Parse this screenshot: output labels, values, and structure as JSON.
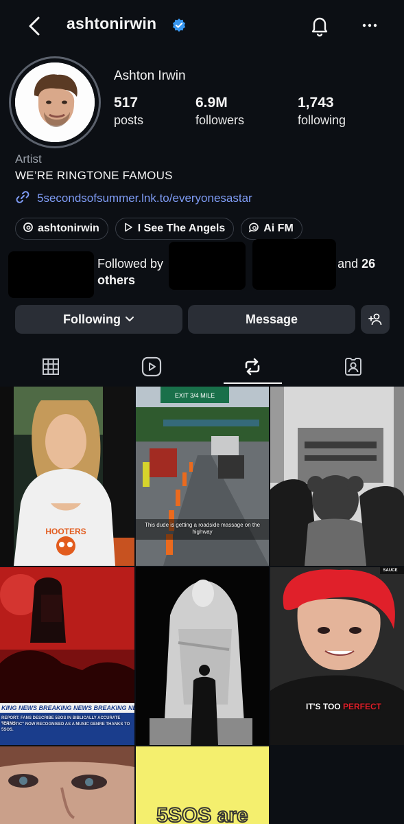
{
  "header": {
    "username": "ashtonirwin",
    "icons": [
      "chevron-left-icon",
      "verified-badge-icon",
      "bell-icon",
      "more-dots-icon"
    ]
  },
  "profile": {
    "display_name": "Ashton Irwin",
    "stats": {
      "posts": {
        "value": "517",
        "label": "posts"
      },
      "followers": {
        "value": "6.9M",
        "label": "followers"
      },
      "following": {
        "value": "1,743",
        "label": "following"
      }
    },
    "category": "Artist",
    "bio": "WE’RE RINGTONE FAMOUS",
    "link": "5secondsofsummer.lnk.to/everyonesastar",
    "chips": [
      {
        "label": "ashtonirwin",
        "icon": "threads-icon"
      },
      {
        "label": "I See The Angels",
        "icon": "play-icon"
      },
      {
        "label": "Ai FM",
        "icon": "chat-bubble-icon"
      }
    ],
    "followed_by": {
      "prefix": "Followed by",
      "comma": ",",
      "suffix_and": "and",
      "count": "26",
      "others": "others"
    }
  },
  "actions": {
    "following_label": "Following",
    "message_label": "Message",
    "add_user_icon": "add-user-icon"
  },
  "tabs": [
    "grid-icon",
    "reels-icon",
    "reposts-icon",
    "tagged-icon"
  ],
  "active_tab": "reposts",
  "grid": {
    "captions": {
      "roadside": "This dude is getting a roadside massage on the highway",
      "sign_exit": "EXIT 3/4 MILE",
      "sauce": "SAUCE",
      "breaking": "KING NEWS BREAKING NEWS BREAKING NEWS BREA",
      "report_line1": "REPORT: FANS DESCRIBE 5SOS IN BIBLICALLY ACCURATE TERMS.",
      "report_line2": "\"CHAOTIC\" NOW RECOGNISED AS A MUSIC GENRE THANKS TO 5SOS.",
      "too_perfect_a": "IT'S TOO",
      "too_perfect_b": "PERFECT",
      "fivesos": "5SOS are",
      "shirt": "HOOTERS"
    }
  },
  "colors": {
    "background": "#0c0f14",
    "button": "#2a2e36",
    "link": "#7f9cf5",
    "verified": "#3897f0",
    "accent_red": "#e0202a"
  }
}
